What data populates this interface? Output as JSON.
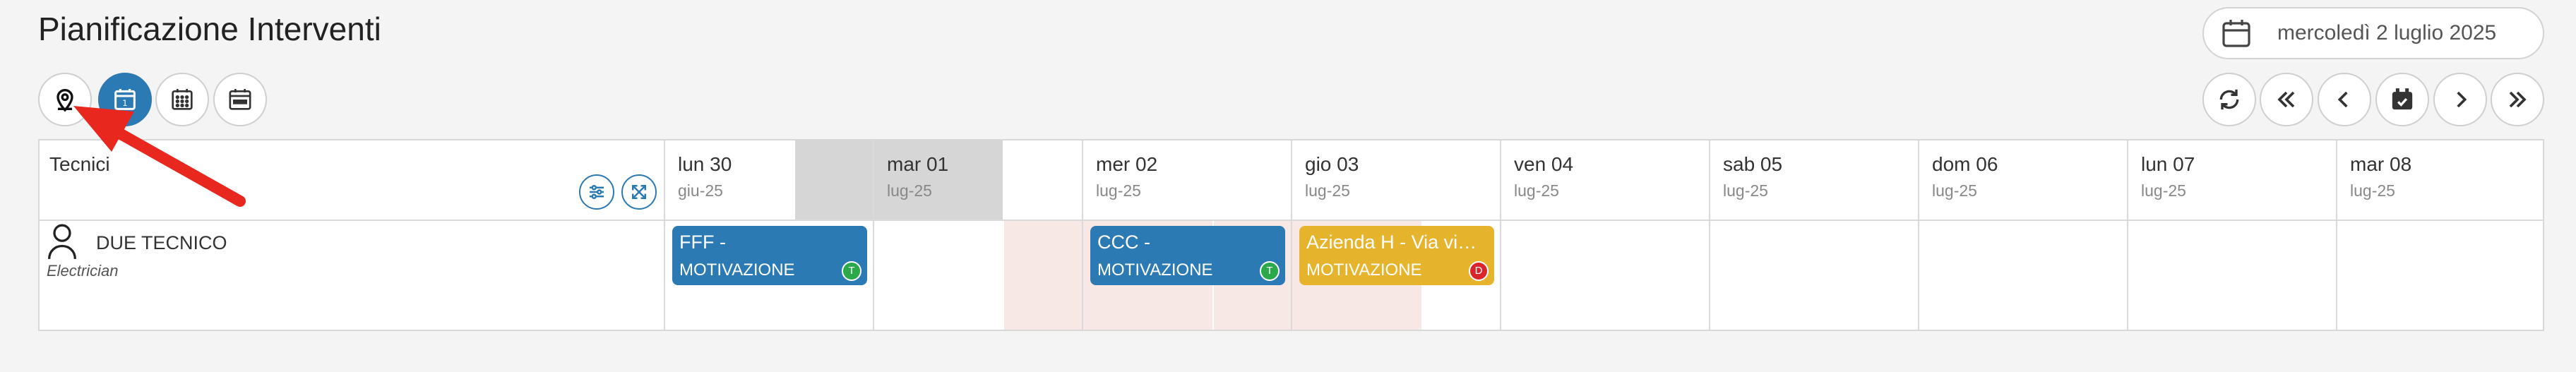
{
  "header": {
    "title": "Pianificazione Interventi",
    "date": "mercoledì 2 luglio 2025"
  },
  "view_buttons": [
    {
      "icon": "map-pin-icon"
    },
    {
      "icon": "calendar-day-icon"
    },
    {
      "icon": "calendar-grid-icon"
    },
    {
      "icon": "calendar-week-icon"
    }
  ],
  "nav_buttons": [
    {
      "icon": "refresh-icon"
    },
    {
      "icon": "double-left-icon"
    },
    {
      "icon": "left-icon"
    },
    {
      "icon": "calendar-today-icon"
    },
    {
      "icon": "right-icon"
    },
    {
      "icon": "double-right-icon"
    }
  ],
  "grid": {
    "tech_header": "Tecnici",
    "days": [
      {
        "name": "lun 30",
        "month": "giu-25"
      },
      {
        "name": "mar 01",
        "month": "lug-25"
      },
      {
        "name": "mer 02",
        "month": "lug-25"
      },
      {
        "name": "gio 03",
        "month": "lug-25"
      },
      {
        "name": "ven 04",
        "month": "lug-25"
      },
      {
        "name": "sab 05",
        "month": "lug-25"
      },
      {
        "name": "dom 06",
        "month": "lug-25"
      },
      {
        "name": "lun 07",
        "month": "lug-25"
      },
      {
        "name": "mar 08",
        "month": "lug-25"
      }
    ],
    "technicians": [
      {
        "name": "DUE TECNICO",
        "role": "Electrician",
        "events": [
          {
            "title": "FFF -",
            "subtitle": "MOTIVAZIONE",
            "badge": "T",
            "color": "#2b7ab3",
            "badge_color": "#2aa84a"
          },
          {
            "title": "CCC -",
            "subtitle": "MOTIVAZIONE",
            "badge": "T",
            "color": "#2b7ab3",
            "badge_color": "#2aa84a"
          },
          {
            "title": "Azienda H - Via viani...",
            "subtitle": "MOTIVAZIONE",
            "badge": "D",
            "color": "#e6b32c",
            "badge_color": "#d9262c"
          }
        ]
      }
    ]
  },
  "colors": {
    "accent": "#2b7ab3",
    "today_header": "#d6d6d6",
    "weekend": "#f7e8e6",
    "annotation_arrow": "#e8281e"
  }
}
